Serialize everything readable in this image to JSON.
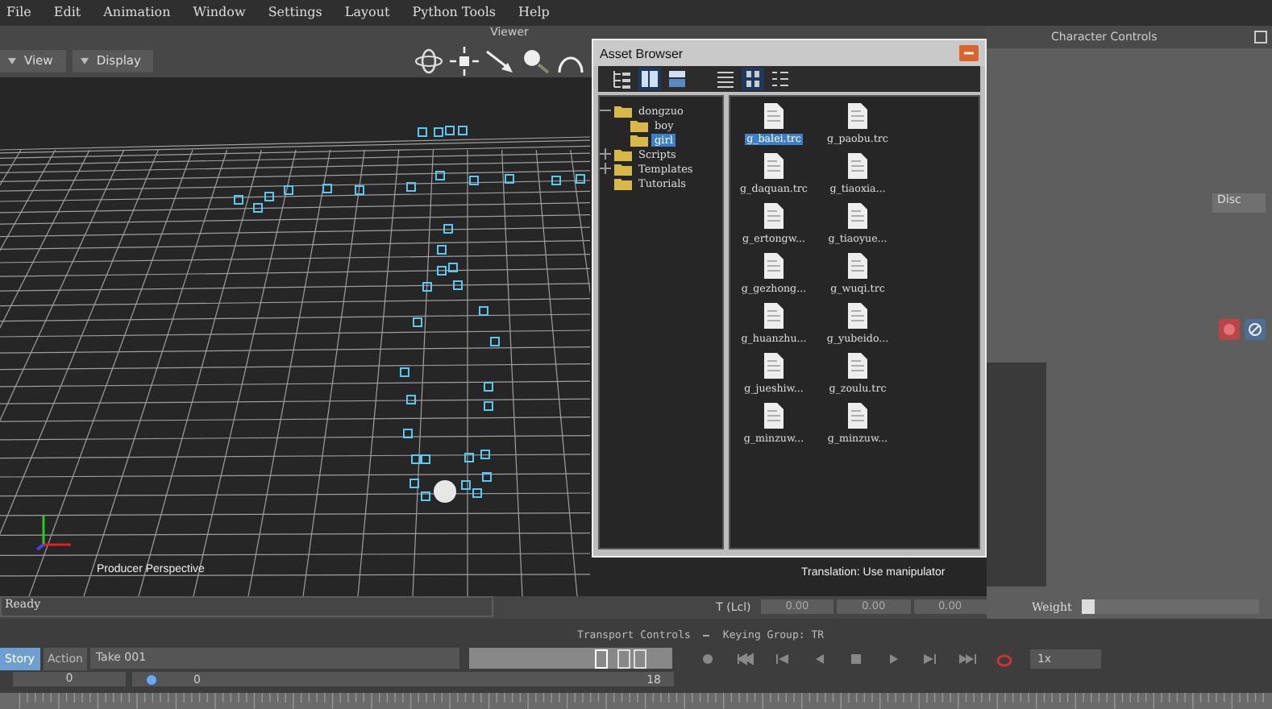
{
  "menu_bar": {
    "items": [
      "File",
      "Edit",
      "Animation",
      "Window",
      "Settings",
      "Layout",
      "Python Tools",
      "Help"
    ]
  },
  "viewer": {
    "title": "Viewer",
    "buttons": [
      {
        "label": "View"
      },
      {
        "label": "Display"
      }
    ],
    "camera_label": "Producer Perspective",
    "manipulator_hint": "Translation: Use manipulator"
  },
  "status_bar": {
    "message": "Ready",
    "transform_label": "T (Lcl)",
    "transform_fields": [
      "0.00",
      "0.00",
      "0.00"
    ]
  },
  "character_controls": {
    "title": "Character Controls",
    "field": "Disc",
    "weight_label": "Weight",
    "weight_slider": {
      "level": 0
    }
  },
  "asset_browser": {
    "title": "Asset Browser",
    "view_buttons": [
      {
        "kind": "tree",
        "selected": false
      },
      {
        "kind": "splitv",
        "selected": true
      },
      {
        "kind": "splith",
        "selected": false
      },
      {
        "kind": "list",
        "selected": false
      },
      {
        "kind": "icons",
        "selected": true
      },
      {
        "kind": "details",
        "selected": false
      }
    ],
    "tree": [
      {
        "label": "dongzuo",
        "expanded": true,
        "selected": false,
        "children": [
          {
            "label": "boy",
            "selected": false
          },
          {
            "label": "girl",
            "selected": true
          }
        ]
      },
      {
        "label": "Scripts",
        "expanded": false,
        "selected": false
      },
      {
        "label": "Templates",
        "expanded": false,
        "selected": false
      },
      {
        "label": "Tutorials",
        "selected": false
      }
    ],
    "files": [
      {
        "name": "g_balei.trc",
        "selected": true
      },
      {
        "name": "g_paobu.trc",
        "selected": false
      },
      {
        "name": "g_daquan.trc",
        "selected": false
      },
      {
        "name": "g_tiaoxia...",
        "selected": false
      },
      {
        "name": "g_ertongw...",
        "selected": false
      },
      {
        "name": "g_tiaoyue...",
        "selected": false
      },
      {
        "name": "g_gezhong...",
        "selected": false
      },
      {
        "name": "g_wuqi.trc",
        "selected": false
      },
      {
        "name": "g_huanzhu...",
        "selected": false
      },
      {
        "name": "g_yubeido...",
        "selected": false
      },
      {
        "name": "g_jueshiw...",
        "selected": false
      },
      {
        "name": "g_zoulu.trc",
        "selected": false
      },
      {
        "name": "g_minzuw...",
        "selected": false
      },
      {
        "name": "g_minzuw...",
        "selected": false
      }
    ]
  },
  "transport": {
    "title": "Transport Controls",
    "keying_group": "Keying Group: TR",
    "tabs": [
      {
        "label": "Story",
        "selected": true
      },
      {
        "label": "Action",
        "selected": false
      }
    ],
    "take": "Take 001",
    "speed": "1x",
    "start_frame": "0",
    "current_frame": "0",
    "end_frame": "18",
    "timeline_slider": {
      "level": 0.02
    }
  }
}
